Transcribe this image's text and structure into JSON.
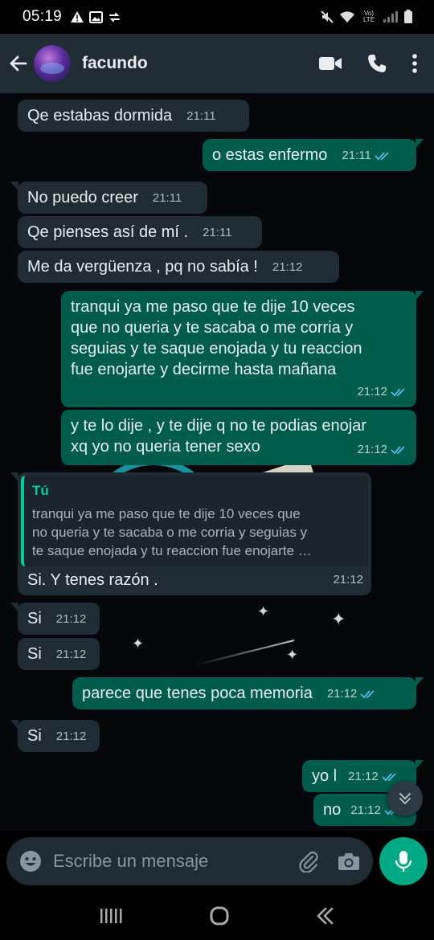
{
  "status_bar": {
    "time": "05:19",
    "network": "Vo) LTE"
  },
  "header": {
    "contact_name": "facundo"
  },
  "messages": [
    {
      "dir": "in",
      "text": "Qe estabas dormida",
      "time": "21:11"
    },
    {
      "dir": "out",
      "text": "o estas enfermo",
      "time": "21:11",
      "status": "read"
    },
    {
      "dir": "in",
      "text": "No puedo creer",
      "time": "21:11"
    },
    {
      "dir": "in",
      "text": "Qe pienses así de mí .",
      "time": "21:11"
    },
    {
      "dir": "in",
      "text": "Me da vergüenza , pq no sabía !",
      "time": "21:12"
    },
    {
      "dir": "out",
      "text": "tranqui ya me paso que te dije 10 veces\nque no queria y te sacaba o me corria y\nseguias y te saque enojada y tu reaccion\nfue enojarte y decirme hasta mañana",
      "time": "21:12",
      "status": "read"
    },
    {
      "dir": "out",
      "text": "y te lo dije , y te dije q no te podias enojar\nxq yo no queria tener sexo",
      "time": "21:12",
      "status": "read"
    },
    {
      "dir": "in",
      "quote_author": "Tú",
      "quote_text": "tranqui ya me paso que te dije 10 veces que\nno queria y te sacaba o me corria y seguias y\nte saque enojada y tu reaccion fue enojarte …",
      "text": "Si. Y tenes razón .",
      "time": "21:12"
    },
    {
      "dir": "in",
      "text": "Si",
      "time": "21:12"
    },
    {
      "dir": "in",
      "text": "Si",
      "time": "21:12"
    },
    {
      "dir": "out",
      "text": "parece que tenes poca memoria",
      "time": "21:12",
      "status": "read"
    },
    {
      "dir": "in",
      "text": "Si",
      "time": "21:12"
    },
    {
      "dir": "out",
      "text": "yo l",
      "time": "21:12",
      "status": "read"
    },
    {
      "dir": "out",
      "text": "no",
      "time": "21:12",
      "status": "read"
    }
  ],
  "composer": {
    "placeholder": "Escribe un mensaje"
  },
  "colors": {
    "header": "#1f2c34",
    "incoming": "#1f2c34",
    "outgoing": "#005c4b",
    "accent": "#00a884",
    "read_ticks": "#53bdeb"
  }
}
